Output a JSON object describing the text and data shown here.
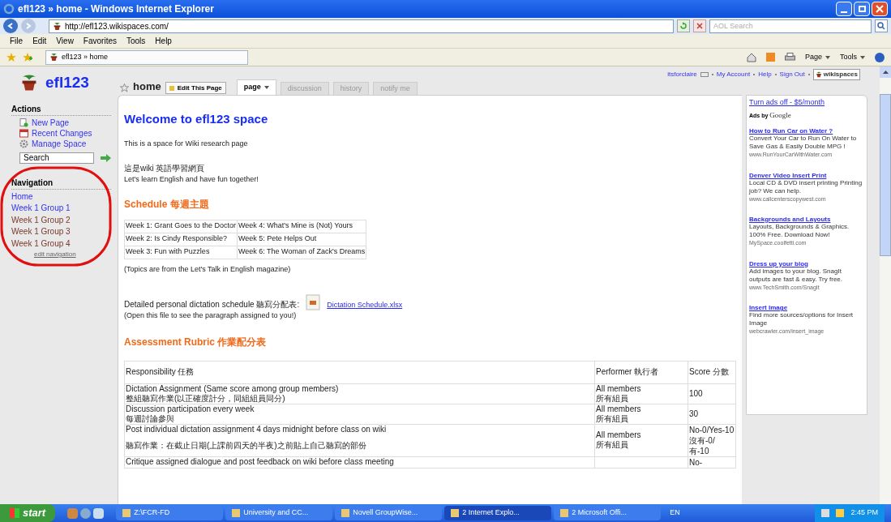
{
  "window": {
    "title": "efl123 » home - Windows Internet Explorer"
  },
  "address_bar": {
    "url": "http://efl123.wikispaces.com/",
    "search_placeholder": "AOL Search"
  },
  "menu": [
    "File",
    "Edit",
    "View",
    "Favorites",
    "Tools",
    "Help"
  ],
  "browser_tab": {
    "label": "efl123 » home"
  },
  "command_bar": [
    "Page",
    "Tools"
  ],
  "site": {
    "name": "efl123"
  },
  "user_links": [
    "itsforclaire",
    "My Account",
    "Help",
    "Sign Out"
  ],
  "wikispaces_badge": "wikispaces",
  "sidebar": {
    "actions_heading": "Actions",
    "actions": [
      {
        "kind": "new",
        "label": "New Page"
      },
      {
        "kind": "changes",
        "label": "Recent Changes"
      },
      {
        "kind": "manage",
        "label": "Manage Space"
      }
    ],
    "search_placeholder": "Search",
    "navigation_heading": "Navigation",
    "navigation": [
      {
        "label": "Home",
        "visited": false
      },
      {
        "label": "Week 1 Group 1",
        "visited": false
      },
      {
        "label": "Week 1 Group 2",
        "visited": true
      },
      {
        "label": "Week 1 Group 3",
        "visited": true
      },
      {
        "label": "Week 1 Group 4",
        "visited": true
      }
    ],
    "edit_navigation": "edit navigation"
  },
  "page_title": "home",
  "edit_button": "Edit This Page",
  "tabs": [
    {
      "label": "page",
      "selected": true
    },
    {
      "label": "discussion",
      "selected": false
    },
    {
      "label": "history",
      "selected": false
    },
    {
      "label": "notify me",
      "selected": false
    }
  ],
  "content": {
    "heading": "Welcome to efl123 space",
    "intro": "This is a space for Wiki research page",
    "intro_zh": "這是wiki 英語學習網頁",
    "intro_2": "Let's learn English and have fun together!",
    "schedule_heading": "Schedule 每週主題",
    "schedule": [
      [
        "Week 1: Grant Goes to the Doctor",
        "Week 4: What's Mine is (Not) Yours"
      ],
      [
        "Week 2: Is Cindy Responsible?",
        "Week 5: Pete Helps Out"
      ],
      [
        "Week 3: Fun with Puzzles",
        "Week 6: The Woman of Zack's Dreams"
      ]
    ],
    "schedule_note": "(Topics are from the Let's Talk in English magazine)",
    "dictation_text": "Detailed personal dictation schedule 聽寫分配表:",
    "dictation_link": "Dictation Schedule.xlsx",
    "dictation_note": "(Open this file to see the paragraph assigned to you!)",
    "rubric_heading": "Assessment Rubric 作業配分表",
    "rubric_columns": [
      "Responsibility 任務",
      "Performer 執行者",
      "Score 分數"
    ],
    "rubric_rows": [
      {
        "responsibility": [
          "Dictation Assignment (Same score among group members)",
          "整組聽寫作業(以正確度計分，同組組員同分)"
        ],
        "performer": [
          "All members",
          "所有組員"
        ],
        "score": [
          "100"
        ]
      },
      {
        "responsibility": [
          "Discussion participation every week",
          "每週討論參與"
        ],
        "performer": [
          "All members",
          "所有組員"
        ],
        "score": [
          "30"
        ]
      },
      {
        "responsibility": [
          "Post individual dictation assignment 4 days midnight before class on wiki",
          "聽寫作業：在截止日期(上課前四天的半夜)之前貼上自己聽寫的部份"
        ],
        "performer": [
          "All members",
          "所有組員"
        ],
        "score": [
          "No-0/Yes-10",
          "沒有-0/有-10"
        ]
      },
      {
        "responsibility": [
          "Critique assigned dialogue and post feedback on wiki before class meeting"
        ],
        "performer": [],
        "score": [
          "No-"
        ]
      }
    ]
  },
  "ads": {
    "turn_off": "Turn ads off - $5/month",
    "ads_by": "Ads by",
    "google": "Google",
    "items": [
      {
        "title": "How to Run Car on Water ?",
        "body": "Convert Your Car to Run On Water to Save Gas & Easily Double MPG !",
        "url": "www.RunYourCarWithWater.com"
      },
      {
        "title": "Denver Video Insert Print",
        "body": "Local CD & DVD insert printing Printing job? We can help.",
        "url": "www.callcenterscopywest.com"
      },
      {
        "title": "Backgrounds and Layouts",
        "body": "Layouts, Backgrounds & Graphics. 100% Free. Download Now!",
        "url": "MySpace.coolfetti.com"
      },
      {
        "title": "Dress up your blog",
        "body": "Add images to your blog. SnagIt outputs are fast & easy. Try free.",
        "url": "www.TechSmith.com/SnagIt"
      },
      {
        "title": "Insert Image",
        "body": "Find more sources/options for Insert Image",
        "url": "webcrawler.com/insert_image"
      }
    ]
  },
  "taskbar": {
    "start": "start",
    "items": [
      {
        "label": "Z:\\FCR-FD",
        "selected": false
      },
      {
        "label": "University and CC...",
        "selected": false
      },
      {
        "label": "Novell GroupWise...",
        "selected": false
      },
      {
        "label": "2 Internet Explo...",
        "selected": true
      },
      {
        "label": "2 Microsoft Offi...",
        "selected": false
      }
    ],
    "language": "EN",
    "clock": "2:45 PM"
  }
}
